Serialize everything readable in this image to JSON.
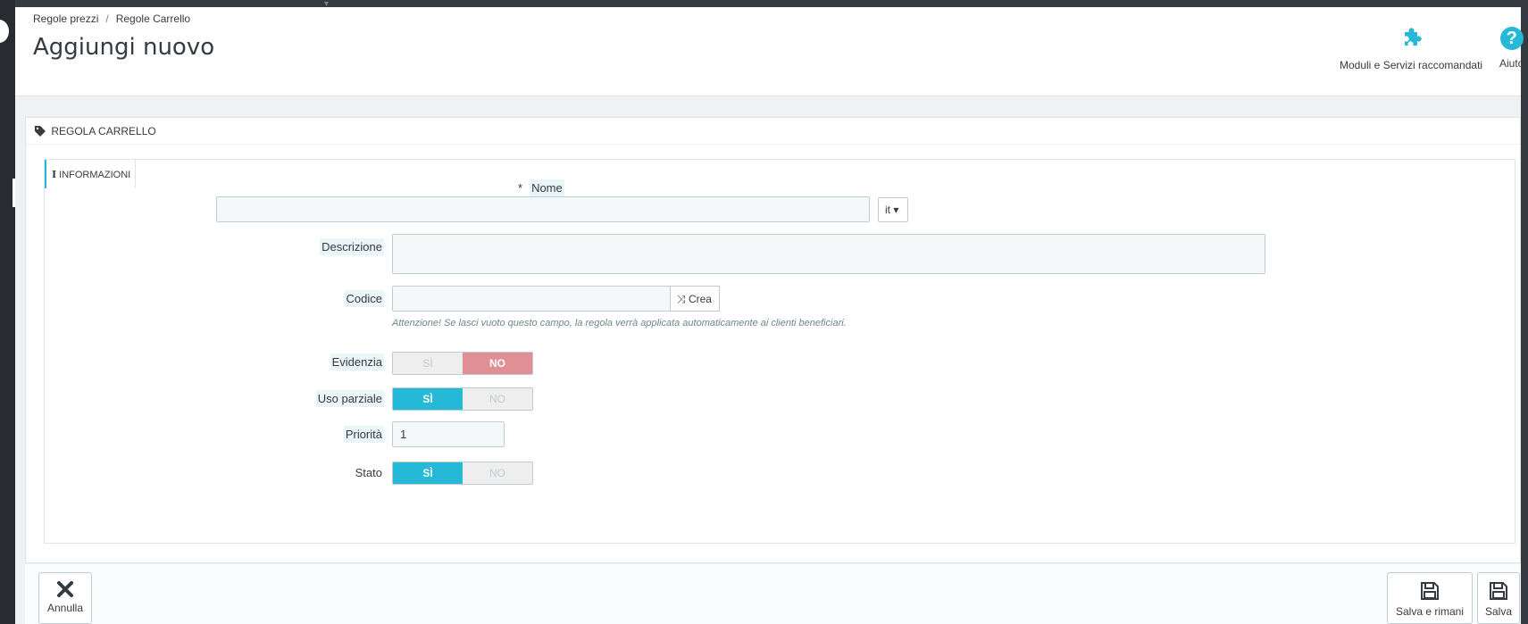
{
  "breadcrumb": {
    "item1": "Regole prezzi",
    "separator": "/",
    "item2": "Regole Carrello"
  },
  "page_title": "Aggiungi nuovo",
  "toolbar": {
    "modules_label": "Moduli e Servizi raccomandati",
    "help_label": "Aiuto",
    "help_icon_glyph": "?"
  },
  "panel": {
    "heading": "REGOLA CARRELLO",
    "tab": "INFORMAZIONI",
    "fields": {
      "name_required_mark": "*",
      "name_label": "Nome",
      "name_value": "",
      "lang_label": "it",
      "description_label": "Descrizione",
      "description_value": "",
      "code_label": "Codice",
      "code_value": "",
      "crea_label": "Crea",
      "code_hint": "Attenzione! Se lasci vuoto questo campo, la regola verrà applicata automaticamente ai clienti beneficiari.",
      "highlight_label": "Evidenzia",
      "partial_use_label": "Uso parziale",
      "priority_label": "Priorità",
      "priority_value": "1",
      "status_label": "Stato",
      "yes": "SÌ",
      "no": "NO"
    }
  },
  "switch_states": {
    "highlight": "no",
    "partial_use": "yes",
    "status": "yes"
  },
  "footer": {
    "cancel_label": "Annulla",
    "save_stay_label": "Salva e rimani",
    "save_label": "Salva"
  },
  "colors": {
    "accent": "#25b9d7",
    "danger_off": "#e08f95",
    "required": "#e0383e"
  }
}
